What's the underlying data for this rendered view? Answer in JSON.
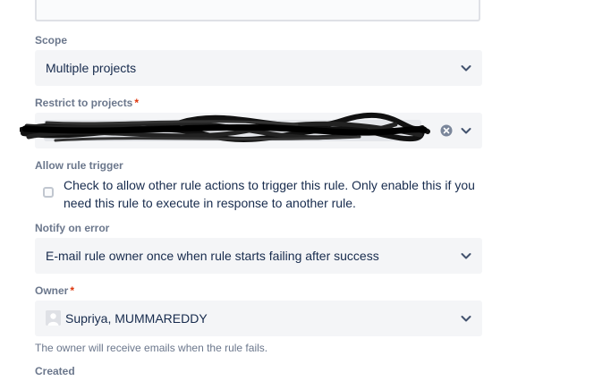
{
  "scope": {
    "label": "Scope",
    "value": "Multiple projects"
  },
  "restrict": {
    "label": "Restrict to projects",
    "required_mark": "*",
    "tag_remove": "×"
  },
  "allow_trigger": {
    "label": "Allow rule trigger",
    "checked": false,
    "text": "Check to allow other rule actions to trigger this rule. Only enable this if you need this rule to execute in response to another rule."
  },
  "notify": {
    "label": "Notify on error",
    "value": "E-mail rule owner once when rule starts failing after success"
  },
  "owner": {
    "label": "Owner",
    "required_mark": "*",
    "value": "Supriya, MUMMAREDDY",
    "helper": "The owner will receive emails when the rule fails."
  },
  "created": {
    "label": "Created"
  },
  "icons": {
    "chevron": "chevron-down-icon",
    "clear": "clear-icon",
    "avatar": "user-avatar-icon"
  }
}
